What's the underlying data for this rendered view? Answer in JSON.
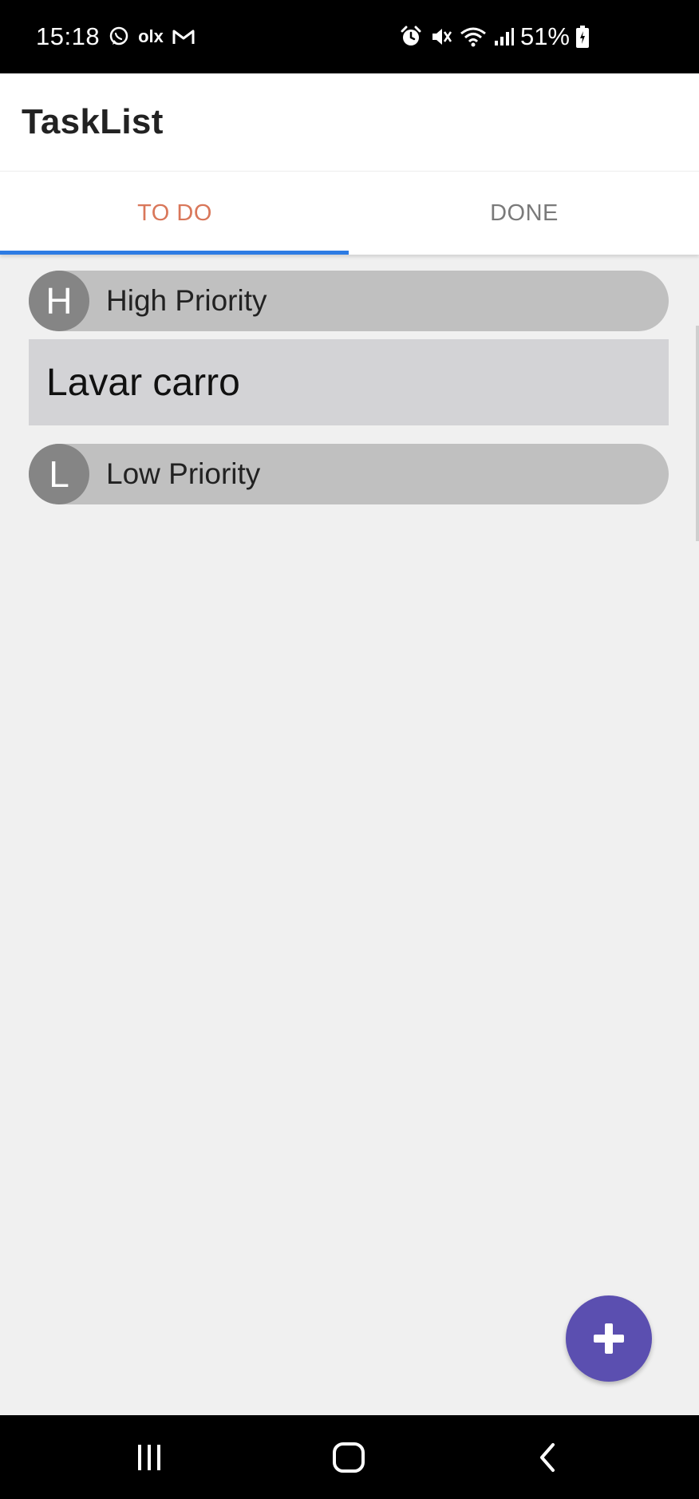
{
  "status_bar": {
    "time": "15:18",
    "notification_icons": [
      "whatsapp-icon",
      "olx-icon",
      "gmail-icon"
    ],
    "olx_text": "olx",
    "system_icons": [
      "alarm-icon",
      "mute-icon",
      "wifi-icon",
      "signal-icon",
      "battery-icon"
    ],
    "battery": "51%"
  },
  "app": {
    "title": "TaskList"
  },
  "tabs": [
    {
      "label": "TO DO",
      "active": true
    },
    {
      "label": "DONE",
      "active": false
    }
  ],
  "groups": {
    "high": {
      "badge": "H",
      "label": "High Priority"
    },
    "low": {
      "badge": "L",
      "label": "Low Priority"
    }
  },
  "tasks": [
    {
      "label": "Lavar carro",
      "priority": "high"
    }
  ],
  "fab": {
    "icon": "plus-icon"
  },
  "colors": {
    "accent_tab": "#d9775a",
    "tab_indicator": "#2d7be3",
    "fab": "#5b4fb0",
    "group_bg": "#c0c0c0",
    "badge_bg": "#858585"
  },
  "nav_bar": {
    "buttons": [
      "recents-icon",
      "home-icon",
      "back-icon"
    ]
  }
}
